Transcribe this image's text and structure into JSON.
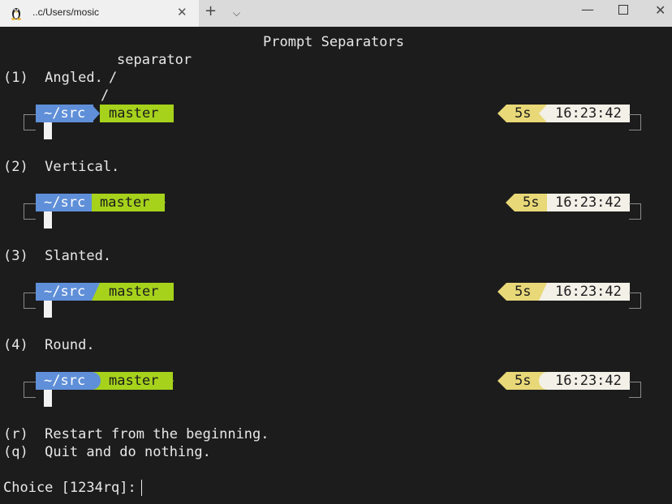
{
  "window": {
    "tab_title": "..c/Users/mosic",
    "icons": {
      "app": "linux-tux-icon",
      "new_tab": "+",
      "dropdown": "⌵",
      "minimize": "—",
      "close": "✕"
    }
  },
  "terminal": {
    "heading": "Prompt Separators",
    "separator_note": "separator",
    "slash_a": "/",
    "slash_b": "/",
    "opt1": "(1)  Angled.",
    "opt2": "(2)  Vertical.",
    "opt3": "(3)  Slanted.",
    "opt4": "(4)  Round.",
    "opt_r": "(r)  Restart from the beginning.",
    "opt_q": "(q)  Quit and do nothing.",
    "choice_prompt": "Choice [1234rq]: ",
    "prompt": {
      "dir": "~/src",
      "branch": "master",
      "duration": "5s",
      "time": "16:23:42"
    },
    "colors": {
      "dir_bg": "#5f8fd8",
      "branch_bg": "#a6d21c",
      "duration_bg": "#e8d878",
      "time_bg": "#f3f0e8"
    }
  }
}
